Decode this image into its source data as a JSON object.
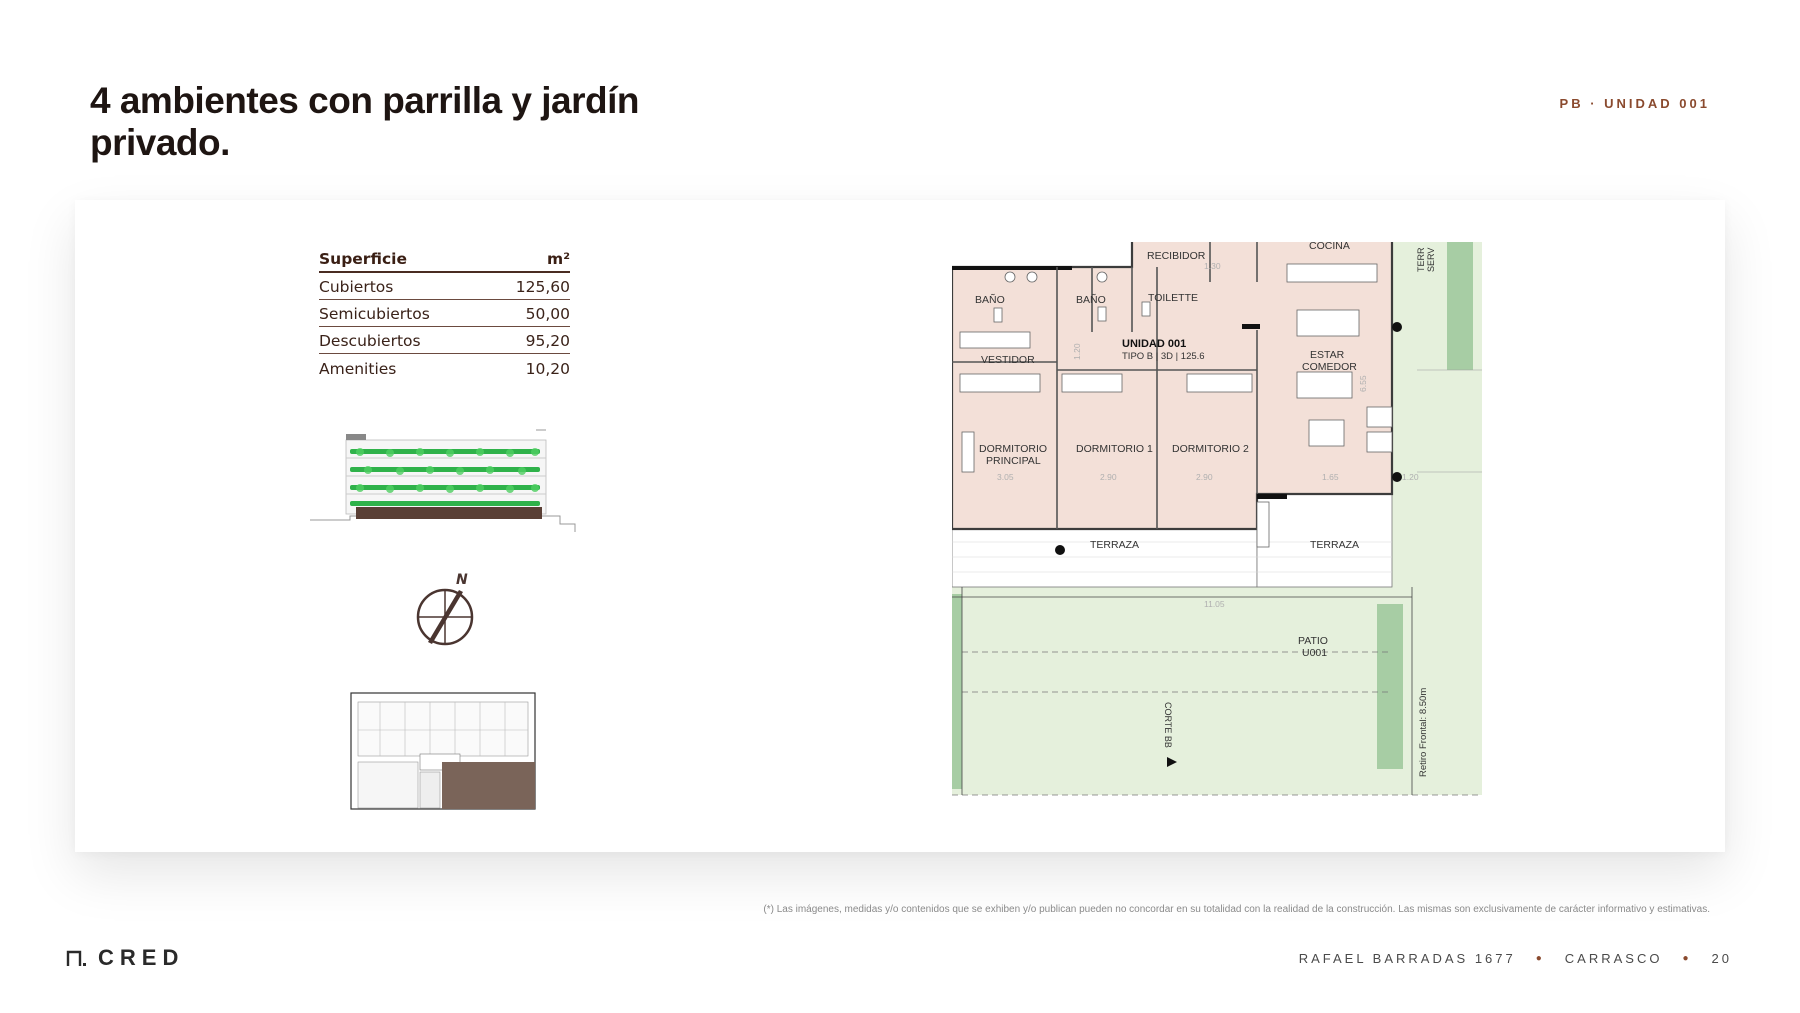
{
  "header": {
    "title": "4 ambientes con parrilla y jardín privado.",
    "unit_tag": "PB · UNIDAD 001"
  },
  "surface_table": {
    "header": {
      "label": "Superficie",
      "unit": "m²"
    },
    "rows": [
      {
        "label": "Cubiertos",
        "value": "125,60"
      },
      {
        "label": "Semicubiertos",
        "value": "50,00"
      },
      {
        "label": "Descubiertos",
        "value": "95,20"
      },
      {
        "label": "Amenities",
        "value": "10,20"
      }
    ]
  },
  "compass": {
    "label": "N"
  },
  "floor_plan": {
    "rooms": {
      "recibidor": "RECIBIDOR",
      "cocina": "COCINA",
      "bano_1": "BAÑO",
      "bano_2": "BAÑO",
      "toilette": "TOILETTE",
      "unit_name": "UNIDAD 001",
      "unit_type": "TIPO B | 3D | 125.6",
      "estar_1": "ESTAR",
      "estar_2": "COMEDOR",
      "vestidor": "VESTIDOR",
      "dorm_principal_1": "DORMITORIO",
      "dorm_principal_2": "PRINCIPAL",
      "dorm_1": "DORMITORIO 1",
      "dorm_2": "DORMITORIO 2",
      "terraza_1": "TERRAZA",
      "terraza_2": "TERRAZA",
      "patio_1": "PATIO",
      "patio_2": "U001",
      "corte": "CORTE BB",
      "retiro": "Retiro Frontal: 8.50m",
      "terr_serv_1": "TERR",
      "terr_serv_2": "SERV"
    },
    "dimensions": {
      "d1": "1.30",
      "d2": "3.05",
      "d3": "2.90",
      "d4": "2.90",
      "d5": "1.65",
      "d6": "1.20",
      "d7": "11.05",
      "d8": "6.55",
      "d9": "1.20"
    },
    "colors": {
      "interior": "#f3e0d8",
      "garden": "#e5f0dc",
      "hedge": "#9cc79a",
      "wall": "#3c3c3c"
    }
  },
  "disclaimer": "(*) Las imágenes, medidas y/o contenidos que se exhiben y/o publican pueden no concordar en su totalidad con la realidad de la construcción. Las mismas son exclusivamente de carácter informativo y estimativas.",
  "brand": {
    "name": "CRED"
  },
  "footer": {
    "address": "RAFAEL BARRADAS 1677",
    "area": "CARRASCO",
    "page": "20"
  }
}
